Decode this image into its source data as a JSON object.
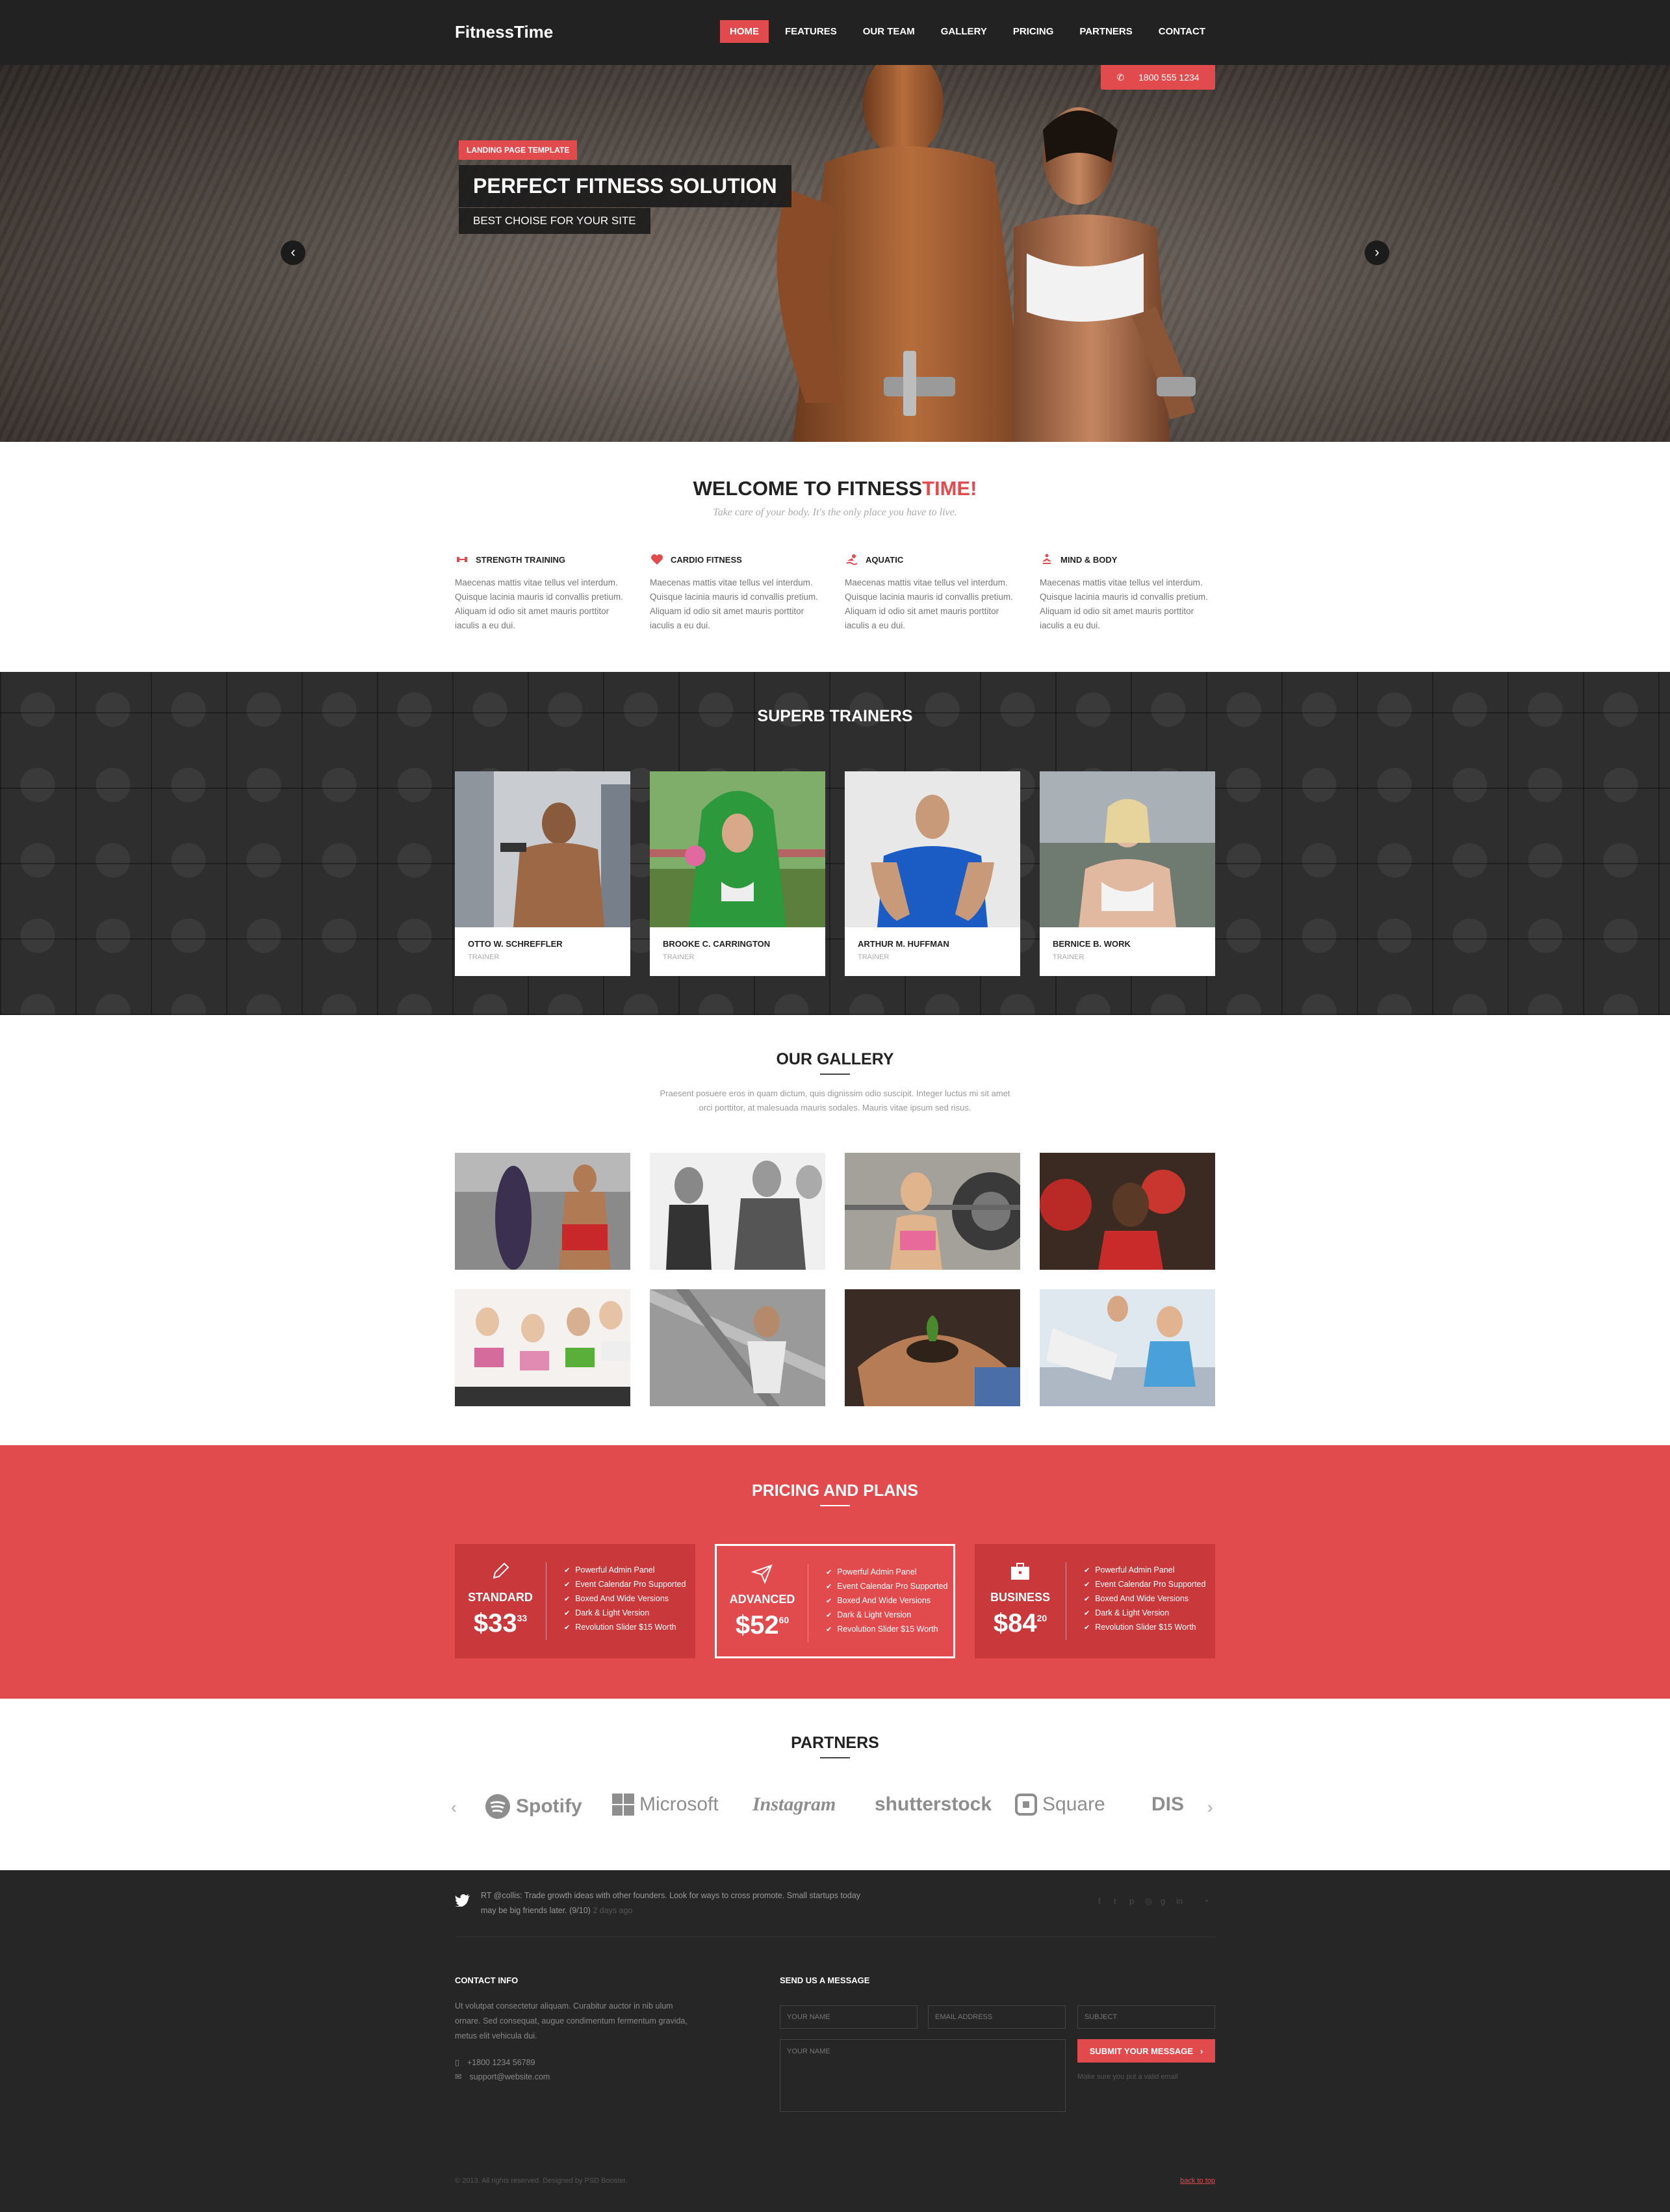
{
  "brand": {
    "logo": "FitnessTime",
    "accent": "#e24b4e",
    "dark": "#222222"
  },
  "nav": {
    "items": [
      "HOME",
      "FEATURES",
      "OUR TEAM",
      "GALLERY",
      "PRICING",
      "PARTNERS",
      "CONTACT"
    ],
    "active": "HOME"
  },
  "hero": {
    "phone": "1800 555 1234",
    "badge": "LANDING PAGE TEMPLATE",
    "title": "PERFECT FITNESS SOLUTION",
    "subtitle": "BEST CHOISE FOR YOUR SITE",
    "prev_icon": "chevron-left-icon",
    "next_icon": "chevron-right-icon"
  },
  "welcome": {
    "title_a": "WELCOME TO FITNESS",
    "title_b": "TIME!",
    "subtitle": "Take care of your body. It's the only place you have to live.",
    "features": [
      {
        "icon": "dumbbell-icon",
        "title": "STRENGTH TRAINING",
        "text": "Maecenas mattis vitae tellus vel interdum. Quisque lacinia mauris id convallis pretium. Aliquam id odio sit amet mauris porttitor iaculis a eu dui."
      },
      {
        "icon": "heart-icon",
        "title": "CARDIO FITNESS",
        "text": "Maecenas mattis vitae tellus vel interdum. Quisque lacinia mauris id convallis pretium. Aliquam id odio sit amet mauris porttitor iaculis a eu dui."
      },
      {
        "icon": "swimmer-icon",
        "title": "AQUATIC",
        "text": "Maecenas mattis vitae tellus vel interdum. Quisque lacinia mauris id convallis pretium. Aliquam id odio sit amet mauris porttitor iaculis a eu dui."
      },
      {
        "icon": "lotus-icon",
        "title": "MIND & BODY",
        "text": "Maecenas mattis vitae tellus vel interdum. Quisque lacinia mauris id convallis pretium. Aliquam id odio sit amet mauris porttitor iaculis a eu dui."
      }
    ]
  },
  "trainers": {
    "title": "SUPERB TRAINERS",
    "items": [
      {
        "name": "OTTO W. SCHREFFLER",
        "role": "TRAINER"
      },
      {
        "name": "BROOKE C. CARRINGTON",
        "role": "TRAINER"
      },
      {
        "name": "ARTHUR M. HUFFMAN",
        "role": "TRAINER"
      },
      {
        "name": "BERNICE B. WORK",
        "role": "TRAINER"
      }
    ]
  },
  "gallery": {
    "title": "OUR GALLERY",
    "desc": "Praesent posuere eros in quam dictum, quis dignissim odio suscipit. Integer luctus mi sit amet orci porttitor, at malesuada mauris sodales. Mauris vitae ipsum sed risus."
  },
  "pricing": {
    "title": "PRICING AND PLANS",
    "plans": [
      {
        "name": "STANDARD",
        "price": "$33",
        "cents": "33",
        "icon": "pencil-icon",
        "features": [
          "Powerful Admin Panel",
          "Event Calendar Pro Supported",
          "Boxed And Wide Versions",
          "Dark & Light Version",
          "Revolution Slider $15 Worth"
        ]
      },
      {
        "name": "ADVANCED",
        "price": "$52",
        "cents": "60",
        "icon": "paper-plane-icon",
        "features": [
          "Powerful Admin Panel",
          "Event Calendar Pro Supported",
          "Boxed And Wide Versions",
          "Dark & Light Version",
          "Revolution Slider $15 Worth"
        ]
      },
      {
        "name": "BUSINESS",
        "price": "$84",
        "cents": "20",
        "icon": "briefcase-icon",
        "features": [
          "Powerful Admin Panel",
          "Event Calendar Pro Supported",
          "Boxed And Wide Versions",
          "Dark & Light Version",
          "Revolution Slider $15 Worth"
        ]
      }
    ]
  },
  "partners": {
    "title": "PARTNERS",
    "logos": [
      "Spotify",
      "Microsoft",
      "Instagram",
      "shutterstock",
      "Square",
      "DIS"
    ]
  },
  "footer": {
    "tweet": "RT @collis: Trade growth ideas with other founders. Look for ways to cross promote. Small startups today may be big friends later. (9/10)",
    "tweet_ago": "2 days ago",
    "social_icons": [
      "facebook-icon",
      "twitter-icon",
      "pinterest-icon",
      "dribbble-icon",
      "google-plus-icon",
      "linkedin-icon",
      "rss-icon"
    ],
    "contact_title": "CONTACT INFO",
    "contact_text": "Ut volutpat consectetur aliquam. Curabitur auctor in nib ulum ornare. Sed consequat, augue condimentum fermentum gravida, metus elit vehicula dui.",
    "phone": "+1800 1234 56789",
    "email": "support@website.com",
    "form_title": "SEND US A MESSAGE",
    "ph_name": "YOUR NAME",
    "ph_email": "EMAIL ADDRESS",
    "ph_subject": "SUBJECT",
    "ph_message": "YOUR NAME",
    "submit": "SUBMIT YOUR MESSAGE",
    "note": "Make sure you put a valid email",
    "copyright": "© 2013. All rights reserved. Designed by PSD Booster.",
    "back_to_top": "back to top"
  }
}
